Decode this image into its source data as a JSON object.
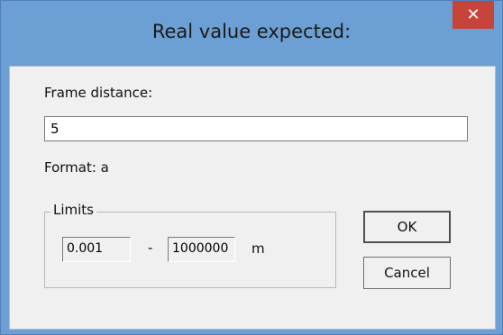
{
  "dialog": {
    "title": "Real value expected:",
    "close_glyph": "✕"
  },
  "form": {
    "field_label": "Frame distance:",
    "field_value": "5",
    "format_text": "Format: a"
  },
  "limits": {
    "group_label": "Limits",
    "min": "0.001",
    "separator": "-",
    "max": "1000000",
    "unit": "m"
  },
  "buttons": {
    "ok": "OK",
    "cancel": "Cancel"
  },
  "colors": {
    "titlebar": "#6c9fd4",
    "close_button": "#c7443b",
    "client": "#f0f0f0"
  }
}
